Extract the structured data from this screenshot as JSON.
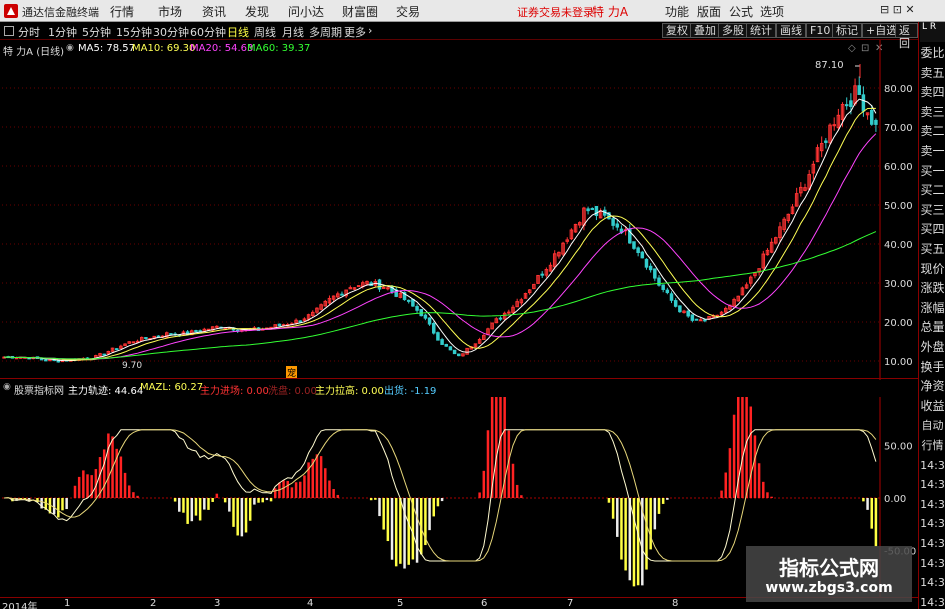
{
  "menubar": {
    "app_name": "通达信金融终端",
    "menus": [
      "行情",
      "市场",
      "资讯",
      "发现",
      "问小达",
      "财富圈",
      "交易"
    ],
    "login_text": "证券交易未登录",
    "stock_name": "特 力A",
    "right_menus": [
      "功能",
      "版面",
      "公式",
      "选项"
    ],
    "window_ctrl": "⊟ ⊡ ✕"
  },
  "toolbar": {
    "periods": [
      "分时",
      "1分钟",
      "5分钟",
      "15分钟",
      "30分钟",
      "60分钟",
      "日线",
      "周线",
      "月线",
      "多周期",
      "更多"
    ],
    "active_period": "日线",
    "right_buttons": [
      "复权",
      "叠加",
      "多股",
      "统计",
      "画线",
      "F10",
      "标记",
      "+自选",
      "返回"
    ]
  },
  "ma_header": {
    "title": "特 力A (日线)",
    "ma5": "MA5: 78.57",
    "ma10": "MA10: 69.30",
    "ma20": "MA20: 54.63",
    "ma60": "MA60: 39.37"
  },
  "main_chart": {
    "price_axis": [
      "80.00",
      "70.00",
      "60.00",
      "50.00",
      "40.00",
      "30.00",
      "20.00",
      "10.00"
    ],
    "high_label": "87.10",
    "low_label": "9.70",
    "marker_label": "宠"
  },
  "indicator_header": {
    "source": "股票指标网",
    "zljj": "主力轨迹: 44.64",
    "mazl": "MAZL: 60.27",
    "zljc": "主力进场: 0.00",
    "xi": "洗盘: 0.00",
    "zlls": "主力拉高: 0.00",
    "ch": "出货: -1.19"
  },
  "indicator_axis": [
    "50.00",
    "0.00",
    "-50.00"
  ],
  "right_panel": {
    "header_letters": "L R",
    "items": [
      "委比",
      "卖五",
      "卖四",
      "卖三",
      "卖二",
      "卖一",
      "买一",
      "买二",
      "买三",
      "买四",
      "买五",
      "现价",
      "涨跌",
      "涨幅",
      "总量",
      "外盘",
      "换手",
      "净资",
      "收益",
      "自动",
      "行情",
      "14:3",
      "14:3",
      "14:3",
      "14:3",
      "14:3",
      "14:3",
      "14:3",
      "14:3"
    ]
  },
  "datebar": {
    "labels": [
      "2014年",
      "1",
      "2",
      "3",
      "4",
      "5",
      "6",
      "7",
      "8"
    ]
  },
  "watermark": {
    "title": "指标公式网",
    "url": "www.zbgs3.com"
  },
  "colors": {
    "up": "#ff3333",
    "down": "#33cccc",
    "ma5": "#ffffff",
    "ma10": "#ffff55",
    "ma20": "#ff44ff",
    "ma60": "#33ff33",
    "hist_up": "#ff2222",
    "hist_down": "#ffff44"
  },
  "chart_data": [
    {
      "type": "candlestick",
      "title": "特 力A (日线)",
      "ylim": [
        9,
        87.1
      ],
      "series": [
        {
          "name": "MA5",
          "values": [
            78.57
          ]
        },
        {
          "name": "MA10",
          "values": [
            69.3
          ]
        },
        {
          "name": "MA20",
          "values": [
            54.63
          ]
        },
        {
          "name": "MA60",
          "values": [
            39.37
          ]
        }
      ],
      "approx_close_path": [
        11,
        11,
        10.5,
        10,
        10.5,
        11,
        13,
        15,
        16,
        17,
        17,
        18,
        19,
        18,
        18,
        19,
        20,
        22,
        26,
        29,
        30,
        29,
        26,
        22,
        15,
        11,
        15,
        20,
        24,
        29,
        35,
        42,
        49,
        47,
        44,
        38,
        30,
        24,
        20,
        21,
        24,
        30,
        38,
        46,
        55,
        65,
        75,
        79,
        70
      ]
    },
    {
      "type": "bar",
      "title": "股票指标网",
      "ylim": [
        -60,
        70
      ],
      "series": [
        {
          "name": "主力轨迹",
          "values": [
            44.64
          ]
        },
        {
          "name": "MAZL",
          "values": [
            60.27
          ]
        },
        {
          "name": "出货",
          "values": [
            -1.19
          ]
        }
      ]
    }
  ]
}
